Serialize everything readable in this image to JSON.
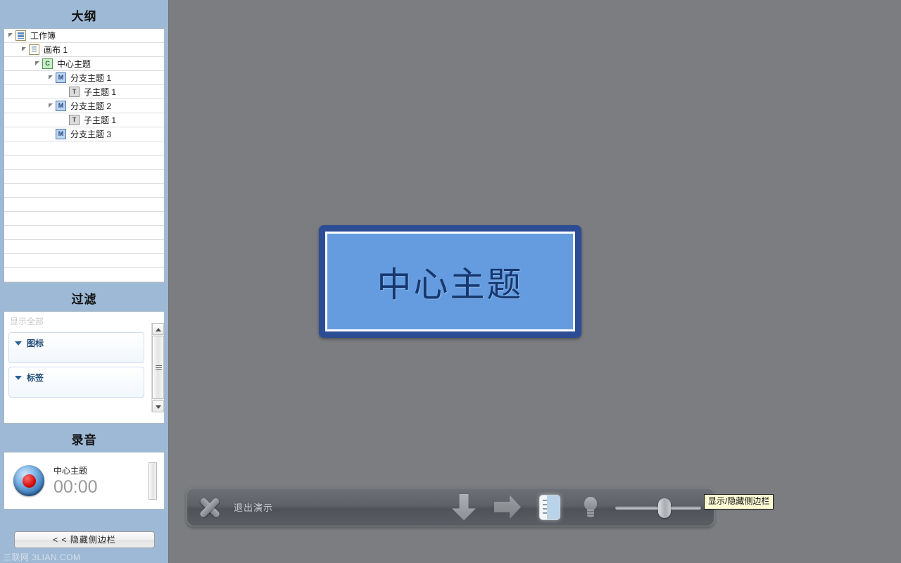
{
  "sidebar": {
    "outline": {
      "title": "大纲",
      "rows": [
        {
          "label": "工作簿",
          "indent": 0,
          "expander": "open",
          "icon": "workbook-icon",
          "icon_kind": "workbook",
          "icon_text": ""
        },
        {
          "label": "画布 1",
          "indent": 1,
          "expander": "open",
          "icon": "canvas-icon",
          "icon_kind": "canvas",
          "icon_text": ""
        },
        {
          "label": "中心主题",
          "indent": 2,
          "expander": "open",
          "icon": "central-topic-icon",
          "icon_kind": "c",
          "icon_text": "C"
        },
        {
          "label": "分支主题 1",
          "indent": 3,
          "expander": "open",
          "icon": "main-topic-icon",
          "icon_kind": "m",
          "icon_text": "M"
        },
        {
          "label": "子主题 1",
          "indent": 4,
          "expander": "none",
          "icon": "sub-topic-icon",
          "icon_kind": "t",
          "icon_text": "T"
        },
        {
          "label": "分支主题 2",
          "indent": 3,
          "expander": "open",
          "icon": "main-topic-icon",
          "icon_kind": "m",
          "icon_text": "M"
        },
        {
          "label": "子主题 1",
          "indent": 4,
          "expander": "none",
          "icon": "sub-topic-icon",
          "icon_kind": "t",
          "icon_text": "T"
        },
        {
          "label": "分支主题 3",
          "indent": 3,
          "expander": "none",
          "icon": "main-topic-icon",
          "icon_kind": "m",
          "icon_text": "M"
        }
      ],
      "empty_rows": 10
    },
    "filter": {
      "title": "过滤",
      "show_all_placeholder": "显示全部",
      "groups": [
        {
          "label": "图标",
          "expander_icon": "triangle-down-icon"
        },
        {
          "label": "标签",
          "expander_icon": "triangle-down-icon"
        }
      ],
      "scrollbar": {
        "up_icon": "scroll-up-arrow-icon",
        "down_icon": "scroll-down-arrow-icon"
      }
    },
    "record": {
      "title": "录音",
      "button_icon": "record-button-icon",
      "topic": "中心主题",
      "timer": "00:00",
      "level_meter_name": "audio-level-meter"
    },
    "hide_sidebar_button": "< <  隐藏侧边栏"
  },
  "stage": {
    "central_topic": "中心主题",
    "colors": {
      "topic_border": "#2c4d96",
      "topic_fill": "#659ce0",
      "topic_text": "#16386e",
      "stage_bg": "#7b7d80",
      "sidebar_bg": "#9db9d6"
    }
  },
  "toolbar": {
    "exit_icon": "close-x-icon",
    "exit_label": "退出演示",
    "down_arrow_icon": "arrow-down-icon",
    "right_arrow_icon": "arrow-right-icon",
    "sidebar_toggle_icon": "sidebar-toggle-icon",
    "bulb_icon": "lightbulb-icon",
    "zoom_slider_name": "zoom-slider",
    "zoom_slider_value": 57,
    "tooltip": "显示/隐藏侧边栏"
  },
  "watermark": "三联网 3LIAN.COM"
}
